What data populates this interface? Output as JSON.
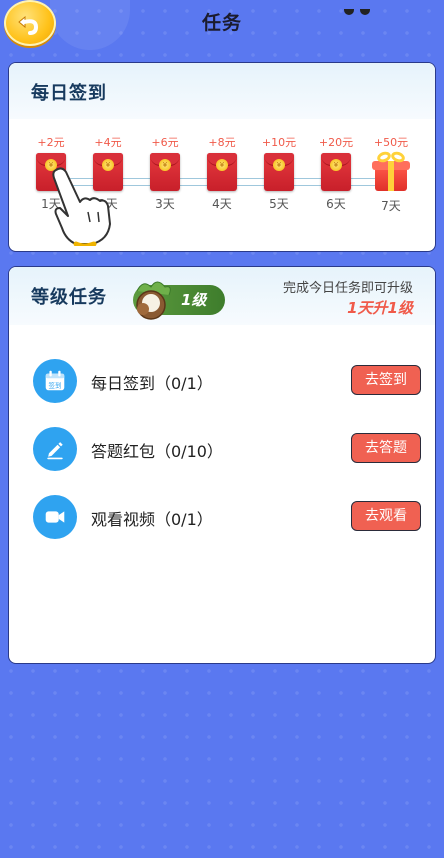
{
  "header": {
    "title": "任务"
  },
  "signin": {
    "title": "每日签到",
    "days": [
      {
        "reward": "+2元",
        "label": "1天"
      },
      {
        "reward": "+4元",
        "label": "2天"
      },
      {
        "reward": "+6元",
        "label": "3天"
      },
      {
        "reward": "+8元",
        "label": "4天"
      },
      {
        "reward": "+10元",
        "label": "5天"
      },
      {
        "reward": "+20元",
        "label": "6天"
      },
      {
        "reward": "+50元",
        "label": "7天"
      }
    ],
    "coin_symbol": "¥"
  },
  "level": {
    "title": "等级任务",
    "badge": "1级",
    "hint": "完成今日任务即可升级",
    "sub": "1天升1级",
    "tasks": [
      {
        "label": "每日签到（0/1）",
        "button": "去签到",
        "icon": "calendar-icon",
        "icon_text": "签到"
      },
      {
        "label": "答题红包（0/10）",
        "button": "去答题",
        "icon": "pencil-icon"
      },
      {
        "label": "观看视频（0/1）",
        "button": "去观看",
        "icon": "video-camera-icon"
      }
    ]
  },
  "colors": {
    "background": "#5a78f0",
    "accent": "#f06152",
    "icon_blue": "#2fa3f0"
  }
}
